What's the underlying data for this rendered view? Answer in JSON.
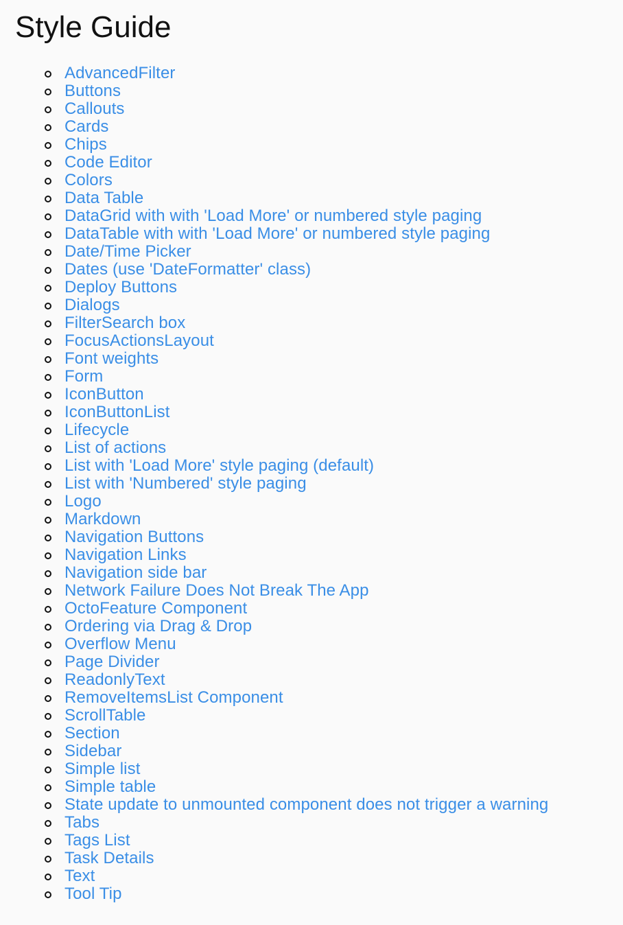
{
  "page": {
    "title": "Style Guide"
  },
  "colors": {
    "link": "#3a8ee6",
    "text": "#111111",
    "background": "#fafafa"
  },
  "links": [
    "AdvancedFilter",
    "Buttons",
    "Callouts",
    "Cards",
    "Chips",
    "Code Editor",
    "Colors",
    "Data Table",
    "DataGrid with with 'Load More' or numbered style paging",
    "DataTable with with 'Load More' or numbered style paging",
    "Date/Time Picker",
    "Dates (use 'DateFormatter' class)",
    "Deploy Buttons",
    "Dialogs",
    "FilterSearch box",
    "FocusActionsLayout",
    "Font weights",
    "Form",
    "IconButton",
    "IconButtonList",
    "Lifecycle",
    "List of actions",
    "List with 'Load More' style paging (default)",
    "List with 'Numbered' style paging",
    "Logo",
    "Markdown",
    "Navigation Buttons",
    "Navigation Links",
    "Navigation side bar",
    "Network Failure Does Not Break The App",
    "OctoFeature Component",
    "Ordering via Drag & Drop",
    "Overflow Menu",
    "Page Divider",
    "ReadonlyText",
    "RemoveItemsList Component",
    "ScrollTable",
    "Section",
    "Sidebar",
    "Simple list",
    "Simple table",
    "State update to unmounted component does not trigger a warning",
    "Tabs",
    "Tags List",
    "Task Details",
    "Text",
    "Tool Tip"
  ]
}
